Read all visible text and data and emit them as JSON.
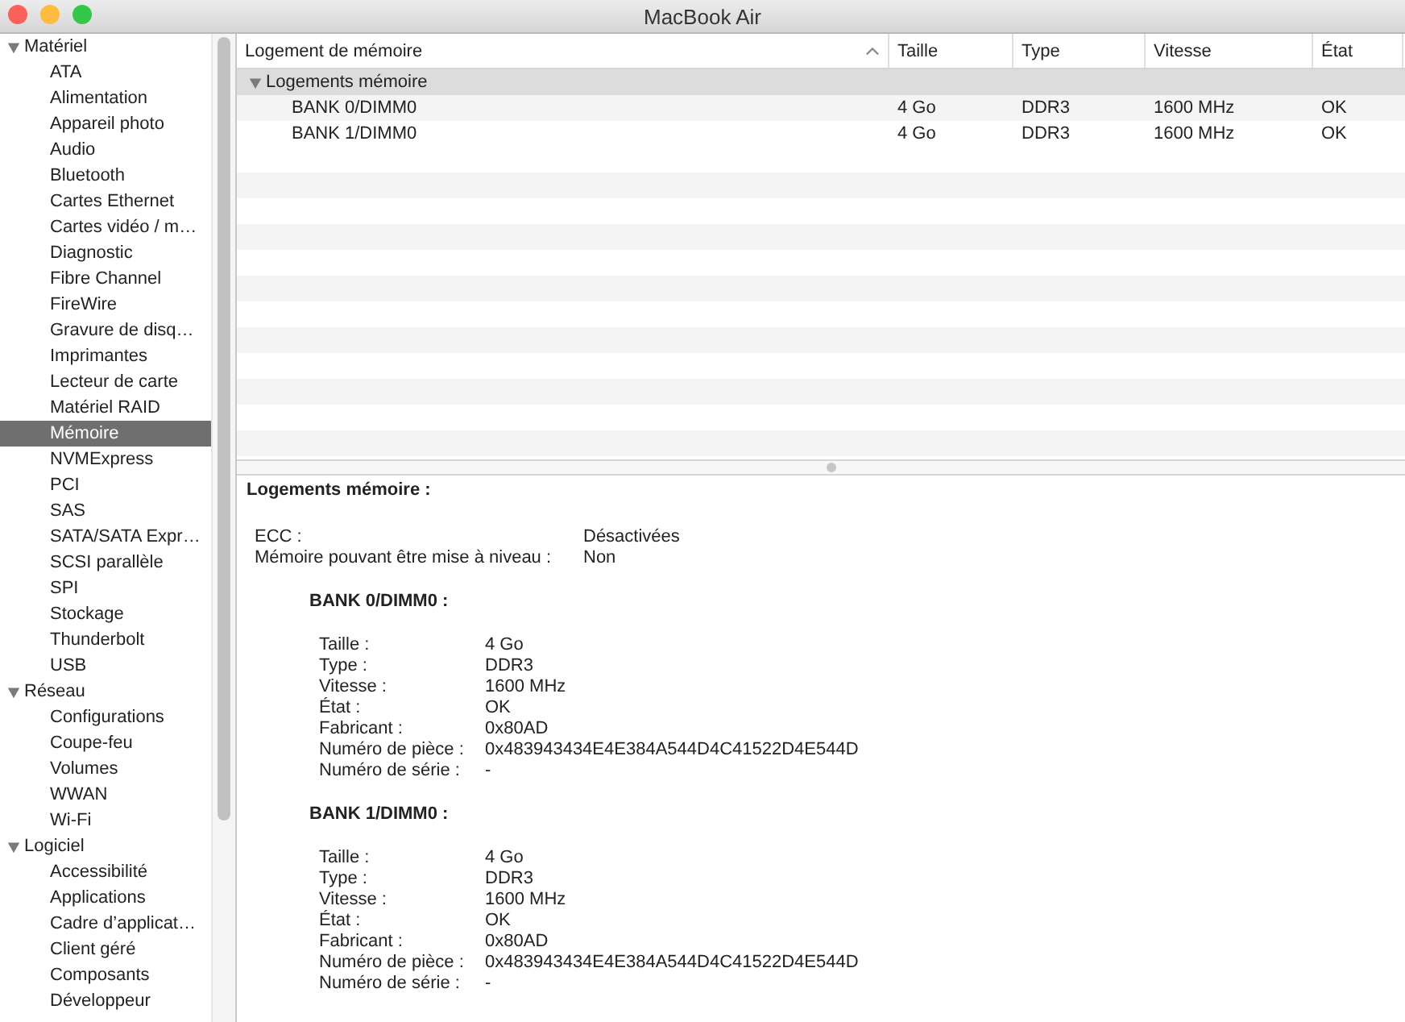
{
  "window": {
    "title": "MacBook Air"
  },
  "sidebar": {
    "groups": [
      {
        "label": "Matériel",
        "expanded": true,
        "children": [
          {
            "label": "ATA",
            "selected": false
          },
          {
            "label": "Alimentation",
            "selected": false
          },
          {
            "label": "Appareil photo",
            "selected": false
          },
          {
            "label": "Audio",
            "selected": false
          },
          {
            "label": "Bluetooth",
            "selected": false
          },
          {
            "label": "Cartes Ethernet",
            "selected": false
          },
          {
            "label": "Cartes vidéo / m…",
            "selected": false
          },
          {
            "label": "Diagnostic",
            "selected": false
          },
          {
            "label": "Fibre Channel",
            "selected": false
          },
          {
            "label": "FireWire",
            "selected": false
          },
          {
            "label": "Gravure de disq…",
            "selected": false
          },
          {
            "label": "Imprimantes",
            "selected": false
          },
          {
            "label": "Lecteur de carte",
            "selected": false
          },
          {
            "label": "Matériel RAID",
            "selected": false
          },
          {
            "label": "Mémoire",
            "selected": true
          },
          {
            "label": "NVMExpress",
            "selected": false
          },
          {
            "label": "PCI",
            "selected": false
          },
          {
            "label": "SAS",
            "selected": false
          },
          {
            "label": "SATA/SATA Expr…",
            "selected": false
          },
          {
            "label": "SCSI parallèle",
            "selected": false
          },
          {
            "label": "SPI",
            "selected": false
          },
          {
            "label": "Stockage",
            "selected": false
          },
          {
            "label": "Thunderbolt",
            "selected": false
          },
          {
            "label": "USB",
            "selected": false
          }
        ]
      },
      {
        "label": "Réseau",
        "expanded": true,
        "children": [
          {
            "label": "Configurations",
            "selected": false
          },
          {
            "label": "Coupe-feu",
            "selected": false
          },
          {
            "label": "Volumes",
            "selected": false
          },
          {
            "label": "WWAN",
            "selected": false
          },
          {
            "label": "Wi-Fi",
            "selected": false
          }
        ]
      },
      {
        "label": "Logiciel",
        "expanded": true,
        "children": [
          {
            "label": "Accessibilité",
            "selected": false
          },
          {
            "label": "Applications",
            "selected": false
          },
          {
            "label": "Cadre d’applicat…",
            "selected": false
          },
          {
            "label": "Client géré",
            "selected": false
          },
          {
            "label": "Composants",
            "selected": false
          },
          {
            "label": "Développeur",
            "selected": false
          }
        ]
      }
    ]
  },
  "table": {
    "columns": [
      {
        "label": "Logement de mémoire",
        "sorted": true
      },
      {
        "label": "Taille",
        "sorted": false
      },
      {
        "label": "Type",
        "sorted": false
      },
      {
        "label": "Vitesse",
        "sorted": false
      },
      {
        "label": "État",
        "sorted": false
      }
    ],
    "groups": [
      {
        "label": "Logements mémoire",
        "expanded": true,
        "rows": [
          [
            "BANK 0/DIMM0",
            "4 Go",
            "DDR3",
            "1600 MHz",
            "OK"
          ],
          [
            "BANK 1/DIMM0",
            "4 Go",
            "DDR3",
            "1600 MHz",
            "OK"
          ]
        ]
      }
    ]
  },
  "detail": {
    "title": "Logements mémoire :",
    "properties": [
      {
        "label": "ECC :",
        "value": "Désactivées"
      },
      {
        "label": "Mémoire pouvant être mise à niveau :",
        "value": "Non"
      }
    ],
    "banks": [
      {
        "title": "BANK 0/DIMM0 :",
        "properties": [
          {
            "label": "Taille :",
            "value": "4 Go"
          },
          {
            "label": "Type :",
            "value": "DDR3"
          },
          {
            "label": "Vitesse :",
            "value": "1600 MHz"
          },
          {
            "label": "État :",
            "value": "OK"
          },
          {
            "label": "Fabricant :",
            "value": "0x80AD"
          },
          {
            "label": "Numéro de pièce :",
            "value": "0x483943434E4E384A544D4C41522D4E544D"
          },
          {
            "label": "Numéro de série :",
            "value": "-"
          }
        ]
      },
      {
        "title": "BANK 1/DIMM0 :",
        "properties": [
          {
            "label": "Taille :",
            "value": "4 Go"
          },
          {
            "label": "Type :",
            "value": "DDR3"
          },
          {
            "label": "Vitesse :",
            "value": "1600 MHz"
          },
          {
            "label": "État :",
            "value": "OK"
          },
          {
            "label": "Fabricant :",
            "value": "0x80AD"
          },
          {
            "label": "Numéro de pièce :",
            "value": "0x483943434E4E384A544D4C41522D4E544D"
          },
          {
            "label": "Numéro de série :",
            "value": "-"
          }
        ]
      }
    ]
  }
}
